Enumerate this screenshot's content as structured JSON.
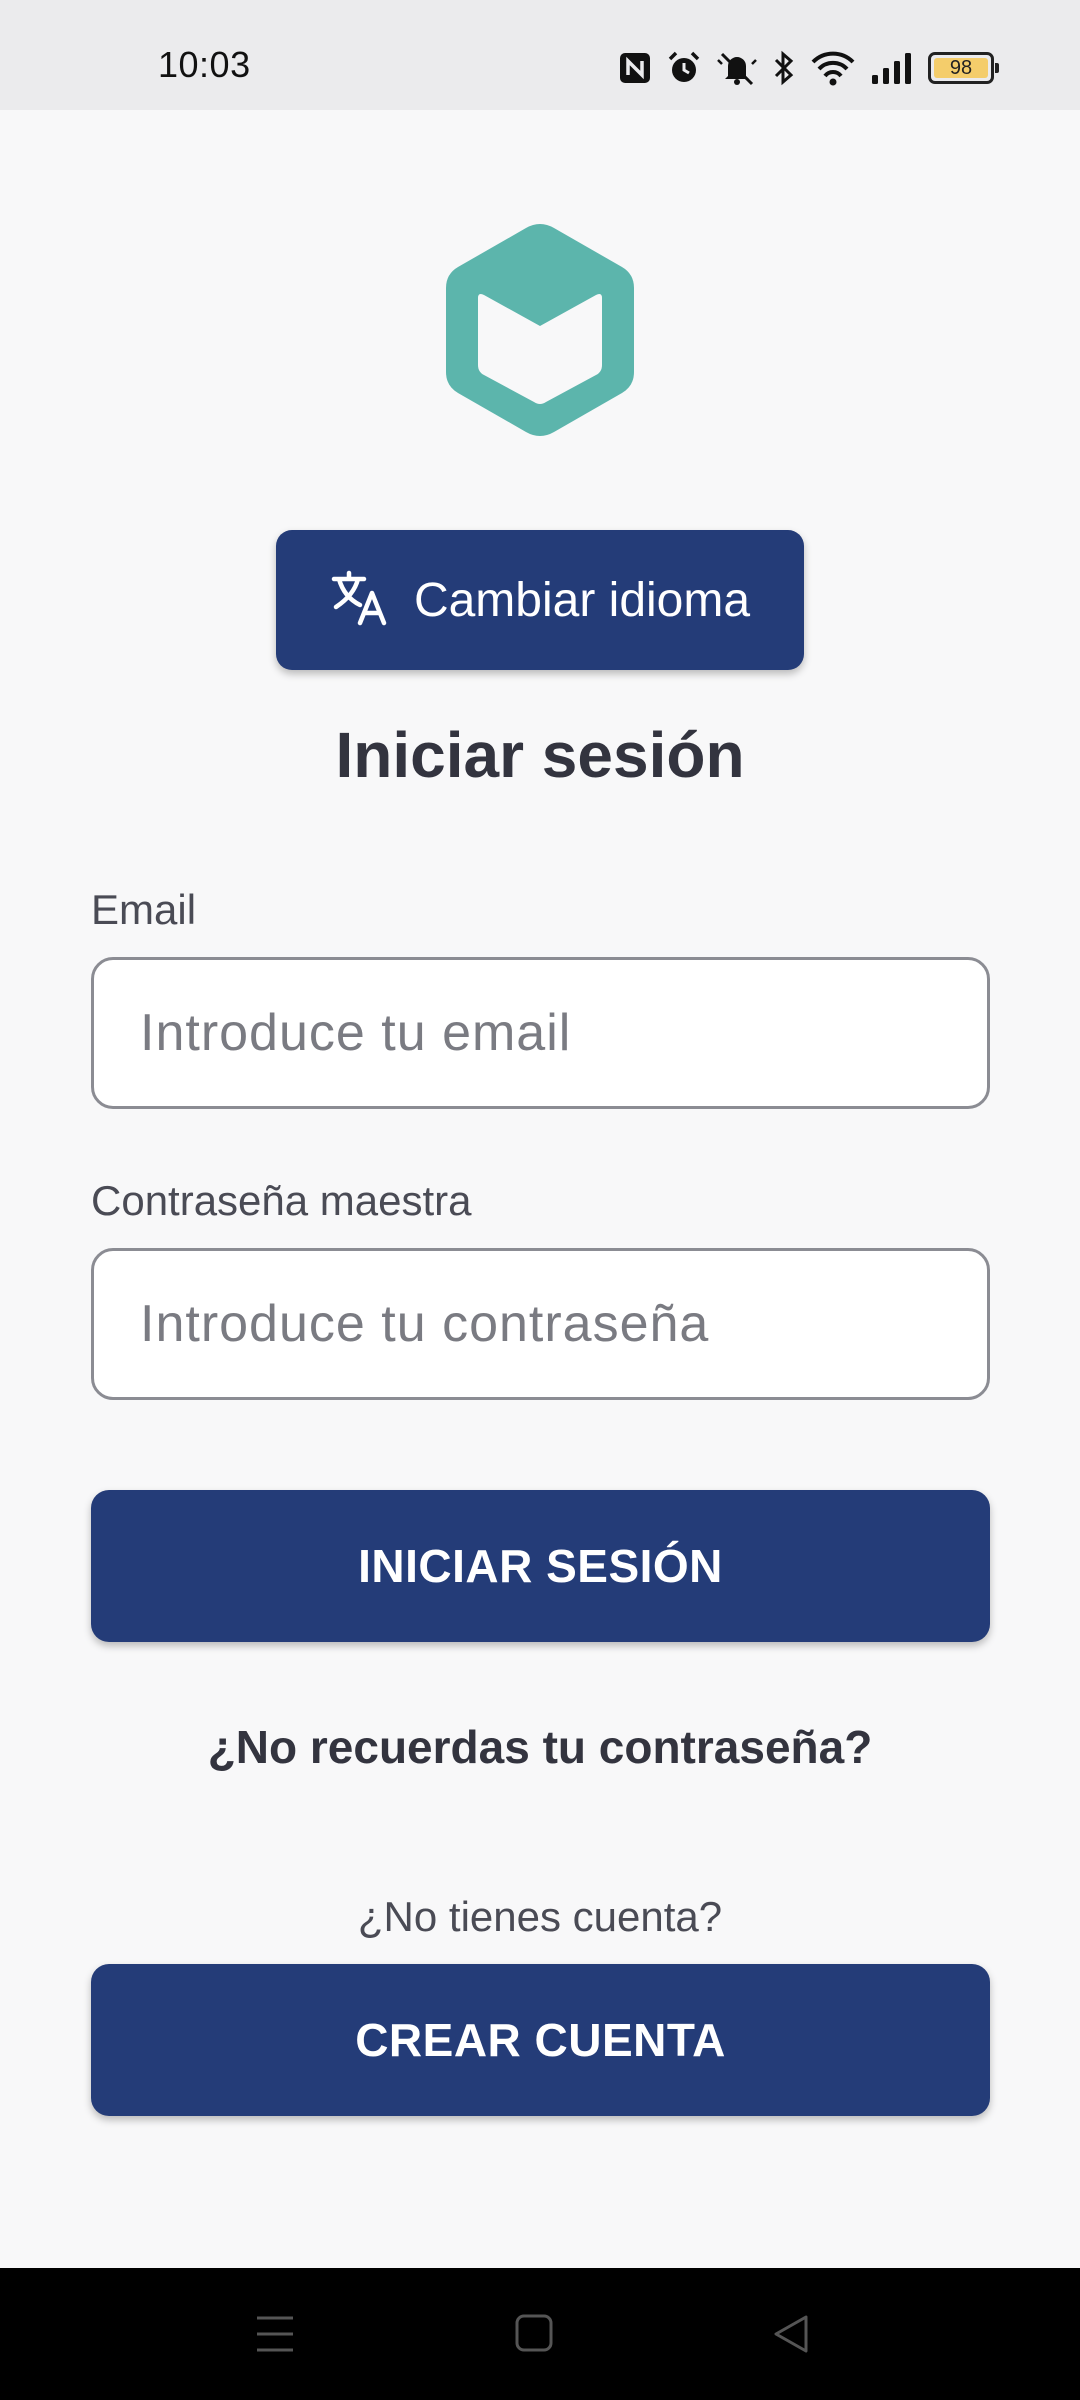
{
  "status_bar": {
    "time": "10:03",
    "battery_level": "98",
    "icons": [
      "nfc-icon",
      "alarm-icon",
      "mute-icon",
      "bluetooth-icon",
      "wifi-icon",
      "signal-icon",
      "battery-icon"
    ]
  },
  "logo": {
    "icon": "hexagon-box-logo",
    "color": "#5cb5ac"
  },
  "language_button": {
    "label": "Cambiar idioma",
    "icon": "translate-icon"
  },
  "title": "Iniciar sesión",
  "email": {
    "label": "Email",
    "placeholder": "Introduce tu email",
    "value": ""
  },
  "password": {
    "label": "Contraseña maestra",
    "placeholder": "Introduce tu contraseña",
    "value": ""
  },
  "login_button": {
    "label": "INICIAR SESIÓN"
  },
  "forgot_password": {
    "label": "¿No recuerdas tu contraseña?"
  },
  "no_account": {
    "label": "¿No tienes cuenta?"
  },
  "create_account_button": {
    "label": "CREAR CUENTA"
  },
  "nav_bar": {
    "buttons": [
      "menu-icon",
      "home-icon",
      "back-icon"
    ]
  },
  "colors": {
    "primary": "#243c78",
    "accent": "#5cb5ac",
    "background": "#f8f8f9",
    "text": "#33343f"
  }
}
